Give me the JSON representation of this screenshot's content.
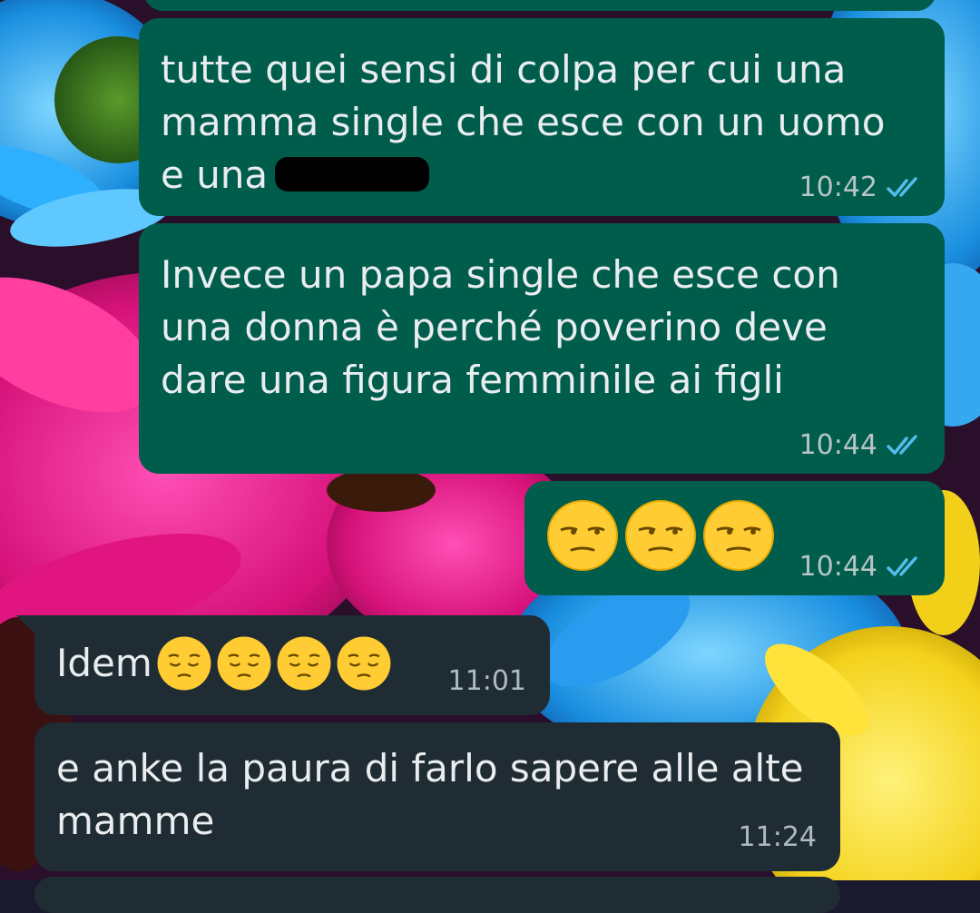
{
  "messages": [
    {
      "direction": "out",
      "text": "",
      "time": "",
      "status": "read"
    },
    {
      "direction": "out",
      "text": "tutte quei sensi di colpa per cui una\nmamma single che esce con un uomo\ne una",
      "redacted": true,
      "time": "10:42",
      "status": "read"
    },
    {
      "direction": "out",
      "text": "Invece un papa single che esce con\nuna donna è perché poverino deve\ndare una figura femminile ai figli",
      "time": "10:44",
      "status": "read"
    },
    {
      "direction": "out",
      "emoji_name": "unamused-face",
      "emoji_count": 3,
      "time": "10:44",
      "status": "read"
    },
    {
      "direction": "in",
      "text": "Idem",
      "emoji_name": "pensive-face",
      "emoji_count": 4,
      "time": "11:01"
    },
    {
      "direction": "in",
      "text": "e anke la paura di farlo sapere alle alte\nmamme",
      "time": "11:24"
    }
  ],
  "colors": {
    "outgoing_bubble": "#005c4b",
    "incoming_bubble": "#202c33",
    "text": "#e9edef",
    "read_ticks": "#53bdeb"
  },
  "icons": {
    "read_receipt": "double-check-icon",
    "redaction": "redaction-mark"
  }
}
